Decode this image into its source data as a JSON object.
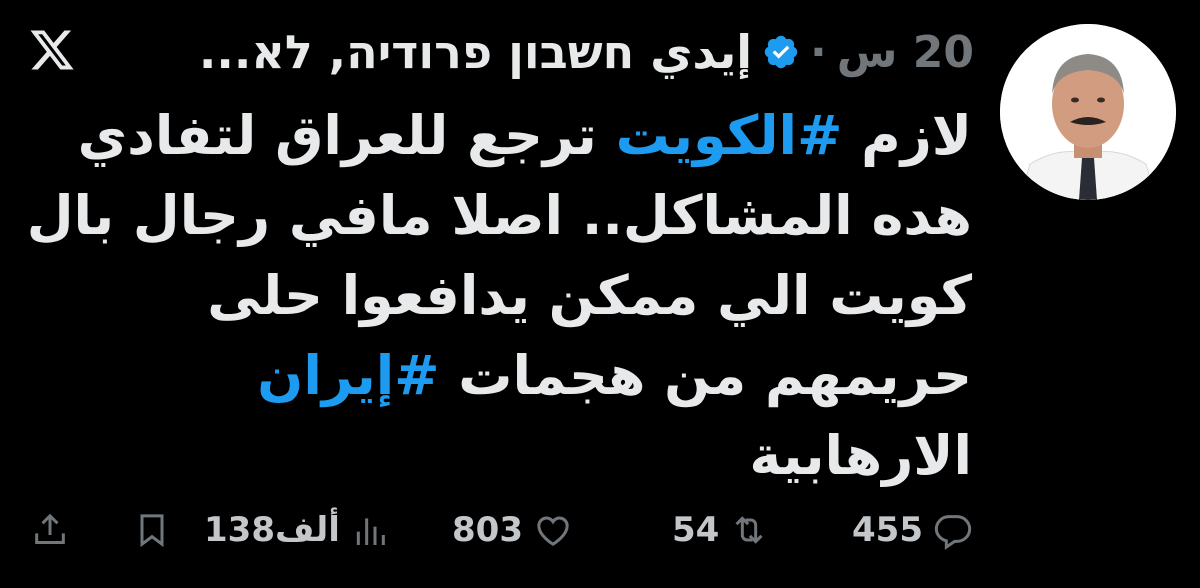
{
  "header": {
    "display_name": "إيدي חשבון פרודיה, לא...",
    "timestamp": "20 س",
    "separator": "·",
    "verified_color": "#1d9bf0"
  },
  "tweet": {
    "lines": [
      {
        "pre": "لازم ",
        "tag": "#الكويت",
        "post": " ترجع للعراق لتفادي"
      },
      {
        "pre": "هده المشاكل.. اصلا مافي رجال بال",
        "tag": "",
        "post": ""
      },
      {
        "pre": "كويت الي ممكن يدافعوا حلى",
        "tag": "",
        "post": ""
      },
      {
        "pre": "حريمهم من هجمات ",
        "tag": "#إيران",
        "post": ""
      },
      {
        "pre": "الارهابية",
        "tag": "",
        "post": ""
      }
    ]
  },
  "actions": {
    "replies": "455",
    "reposts": "54",
    "likes": "803",
    "views": "138ألف"
  },
  "icons": {
    "logo": "x-logo-icon",
    "verified": "verified-badge-icon",
    "reply": "reply-icon",
    "repost": "repost-icon",
    "like": "heart-icon",
    "views": "views-icon",
    "bookmark": "bookmark-icon",
    "share": "share-icon"
  },
  "colors": {
    "background": "#000000",
    "text": "#e7e9ea",
    "muted": "#71767b",
    "accent": "#1d9bf0"
  }
}
